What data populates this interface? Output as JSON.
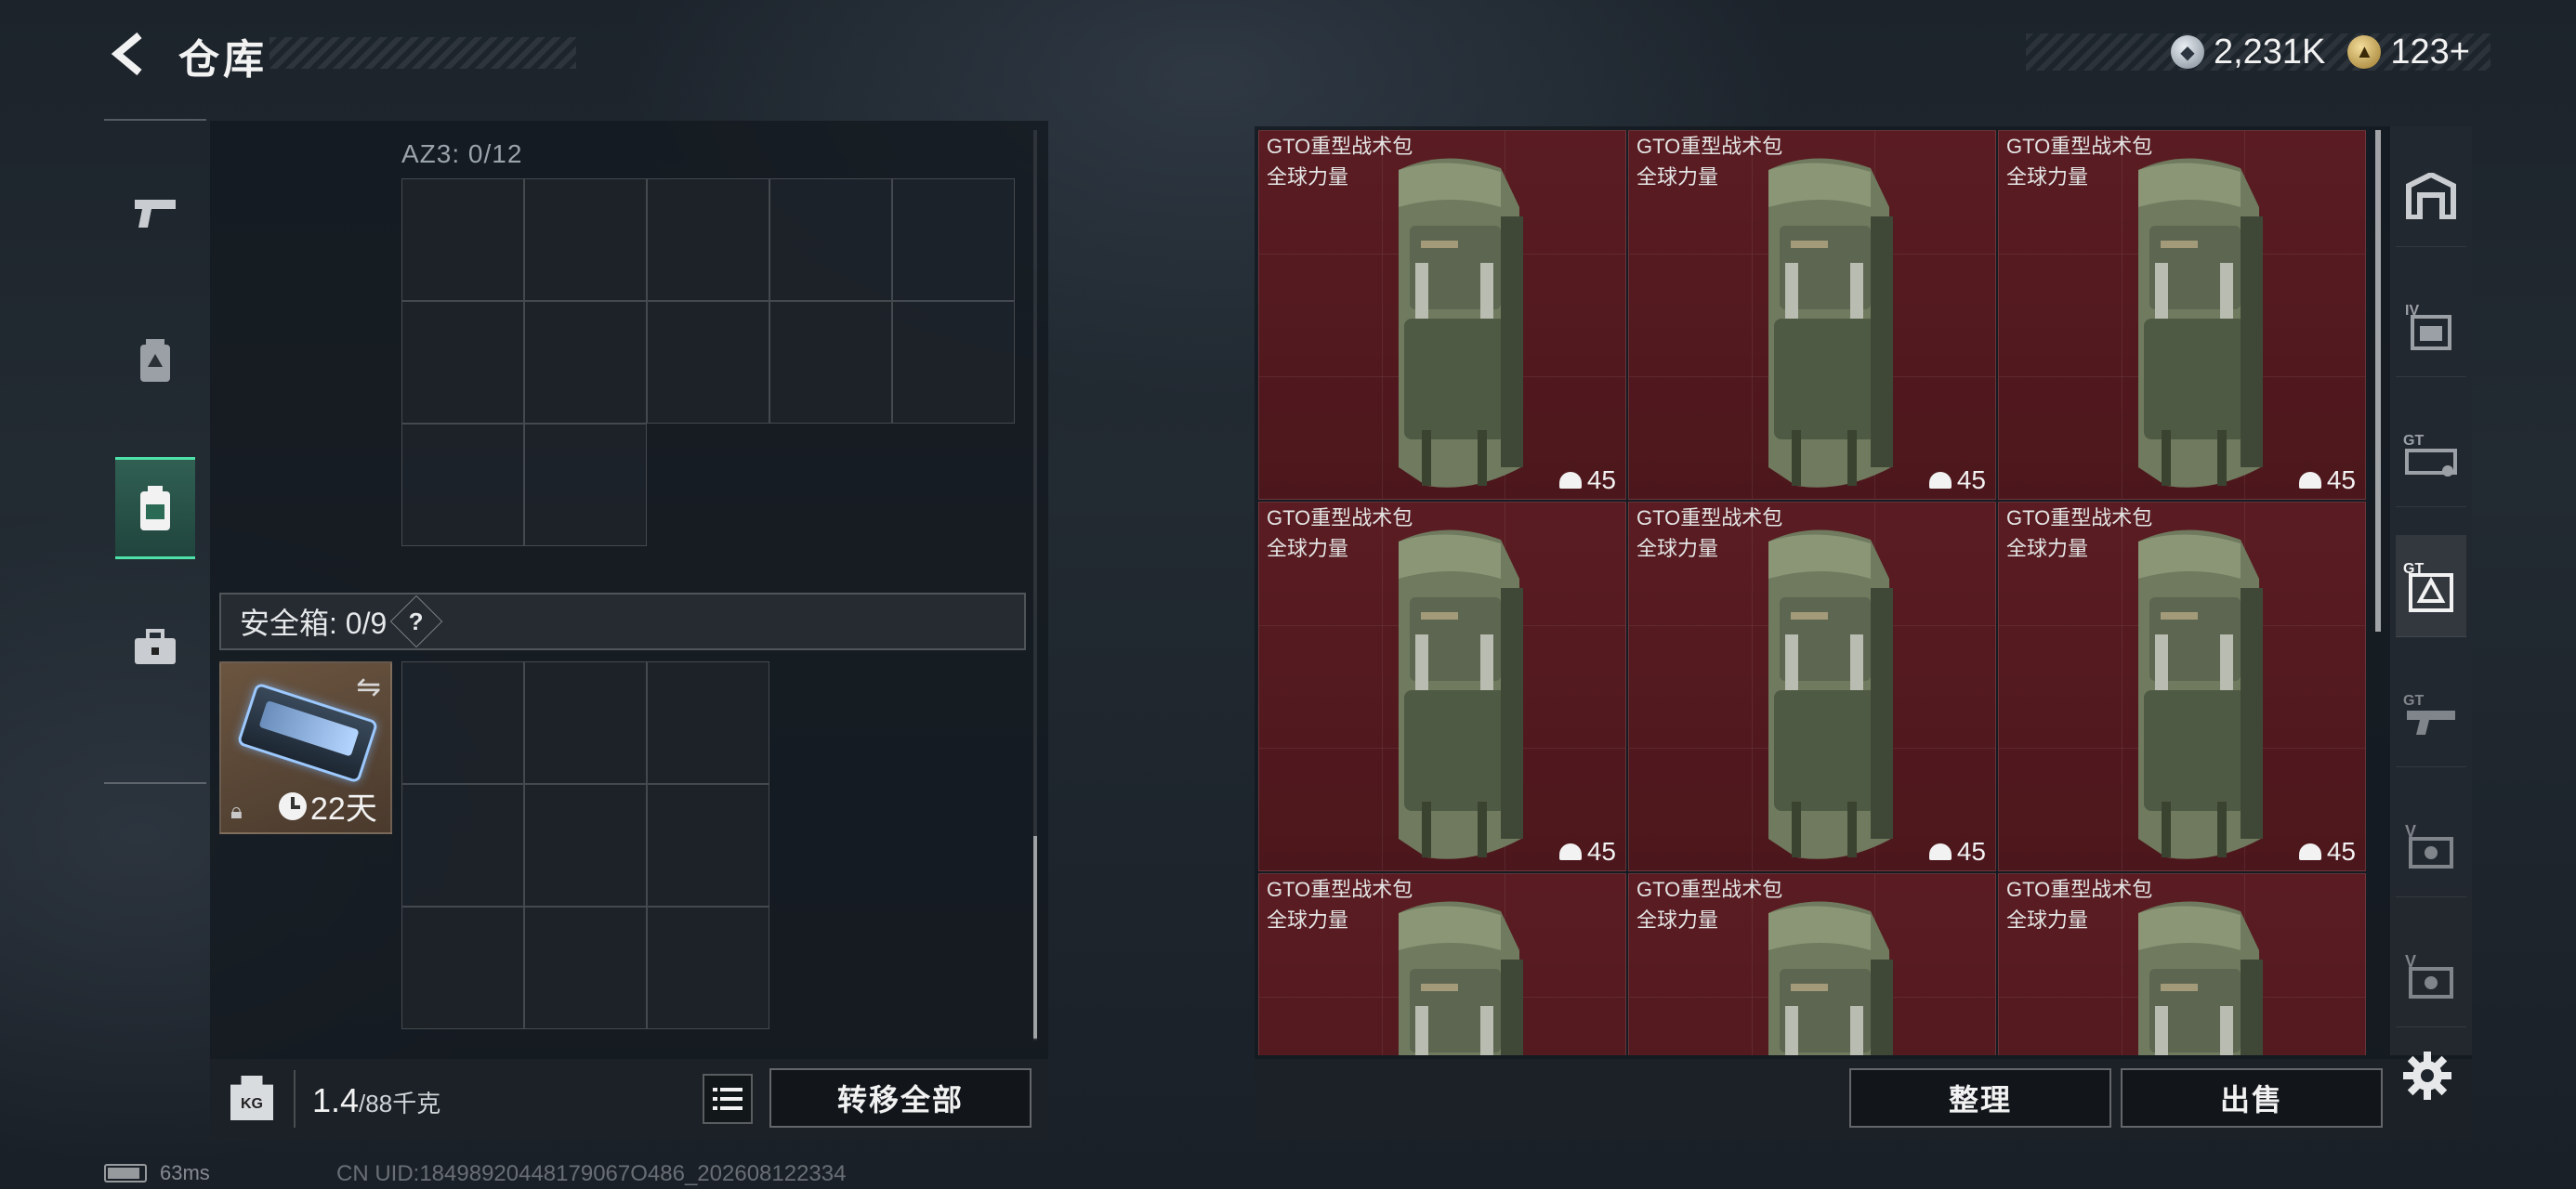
{
  "header": {
    "title": "仓库",
    "currency": [
      {
        "icon": "silver-coin-icon",
        "value": "2,231K"
      },
      {
        "icon": "gold-coin-icon",
        "value": "123+"
      }
    ]
  },
  "left_nav": [
    {
      "icon": "pistol-icon"
    },
    {
      "icon": "vest-icon"
    },
    {
      "icon": "backpack-icon",
      "active": true
    },
    {
      "icon": "toolbox-icon"
    }
  ],
  "left_panel": {
    "az3_label": "AZ3: 0/12",
    "safebox_label": "安全箱: 0/9",
    "help": "?",
    "safe_item": {
      "timer": "22天"
    },
    "weight_value": "1.4",
    "weight_max": "/88千克",
    "kg_icon_text": "KG",
    "transfer_label": "转移全部"
  },
  "stash": {
    "items": [
      {
        "name": "GTO重型战术包",
        "sub": "全球力量",
        "qty": "45"
      },
      {
        "name": "GTO重型战术包",
        "sub": "全球力量",
        "qty": "45"
      },
      {
        "name": "GTO重型战术包",
        "sub": "全球力量",
        "qty": "45"
      },
      {
        "name": "GTO重型战术包",
        "sub": "全球力量",
        "qty": "45"
      },
      {
        "name": "GTO重型战术包",
        "sub": "全球力量",
        "qty": "45"
      },
      {
        "name": "GTO重型战术包",
        "sub": "全球力量",
        "qty": "45"
      },
      {
        "name": "GTO重型战术包",
        "sub": "全球力量",
        "qty": ""
      },
      {
        "name": "GTO重型战术包",
        "sub": "全球力量",
        "qty": ""
      },
      {
        "name": "GTO重型战术包",
        "sub": "全球力量",
        "qty": ""
      }
    ],
    "sort_label": "整理",
    "sell_label": "出售",
    "card_color": "#5a1c22"
  },
  "right_nav": [
    {
      "icon": "home-shelf-icon"
    },
    {
      "icon": "iv-case-icon"
    },
    {
      "icon": "gt-weapon-case-icon"
    },
    {
      "icon": "gt-bag-case-icon",
      "active": true
    },
    {
      "icon": "gt-gun-case-icon"
    },
    {
      "icon": "v-case-icon"
    },
    {
      "icon": "v-case-2-icon"
    }
  ],
  "status": {
    "ping": "63ms",
    "uid": "CN UID:18498920448179067O486_202608122334"
  }
}
